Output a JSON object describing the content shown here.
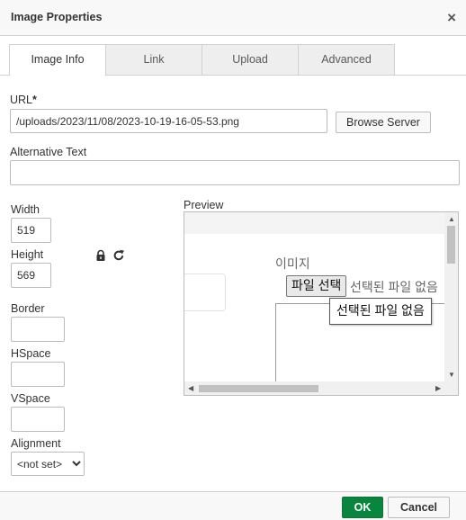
{
  "dialog": {
    "title": "Image Properties",
    "close_glyph": "×"
  },
  "tabs": [
    {
      "label": "Image Info",
      "active": true
    },
    {
      "label": "Link",
      "active": false
    },
    {
      "label": "Upload",
      "active": false
    },
    {
      "label": "Advanced",
      "active": false
    }
  ],
  "form": {
    "url_label": "URL",
    "url_required_mark": "*",
    "url_value": "/uploads/2023/11/08/2023-10-19-16-05-53.png",
    "browse_server_label": "Browse Server",
    "alt_label": "Alternative Text",
    "alt_value": "",
    "width_label": "Width",
    "width_value": "519",
    "height_label": "Height",
    "height_value": "569",
    "lock_icon": "lock-icon",
    "reset_icon": "reset-size-icon",
    "border_label": "Border",
    "border_value": "",
    "hspace_label": "HSpace",
    "hspace_value": "",
    "vspace_label": "VSpace",
    "vspace_value": "",
    "alignment_label": "Alignment",
    "alignment_value": "<not set>"
  },
  "preview": {
    "label": "Preview",
    "heading": "이미지",
    "file_button": "파일 선택",
    "no_file_text": "선택된 파일 없음",
    "tooltip": "선택된 파일 없음"
  },
  "footer": {
    "ok_label": "OK",
    "cancel_label": "Cancel",
    "ok_color": "#09863e"
  }
}
